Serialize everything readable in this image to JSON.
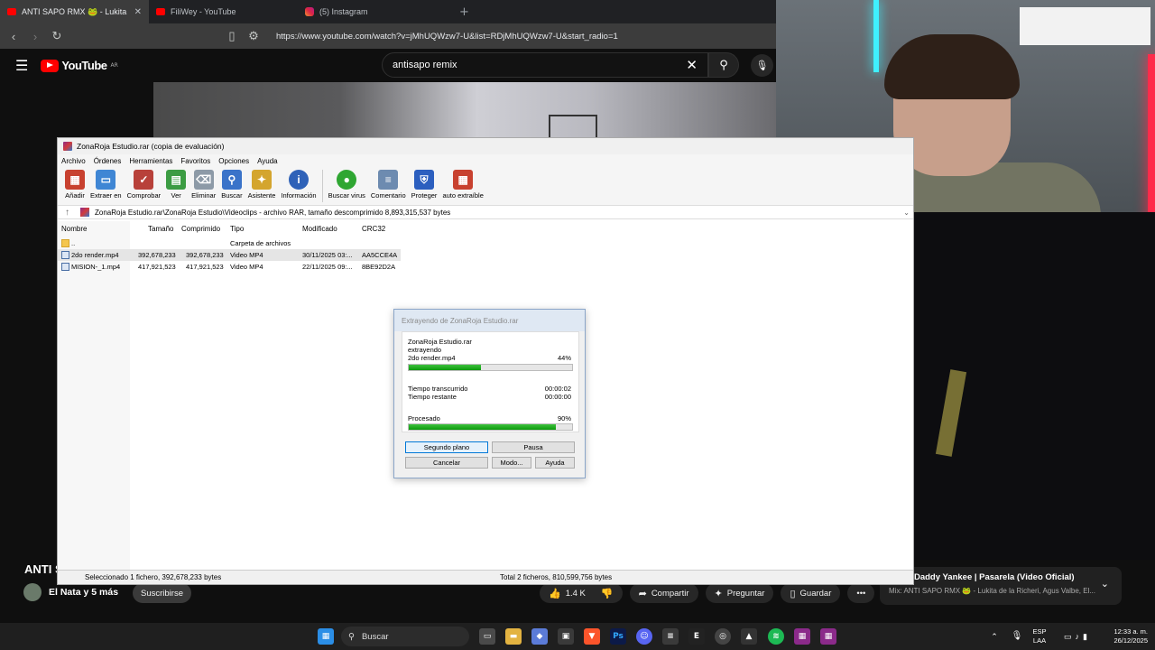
{
  "browser": {
    "tabs": [
      {
        "title": "ANTI SAPO RMX 🐸 - Lukita de",
        "close": "✕"
      },
      {
        "title": "FiliWey - YouTube"
      },
      {
        "title": "(5) Instagram"
      }
    ],
    "new_tab": "+",
    "url": "https://www.youtube.com/watch?v=jMhUQWzw7-U&list=RDjMhUQWzw7-U&start_radio=1"
  },
  "youtube": {
    "logo_text": "YouTube",
    "country": "AR",
    "search_value": "antisapo remix",
    "video_title": "ANTI S",
    "channel_name": "El Nata y 5 más",
    "subscribe_label": "Suscribirse",
    "likes": "1.4 K",
    "share_label": "Compartir",
    "ask_label": "Preguntar",
    "save_label": "Guardar",
    "more_label": "•••",
    "mix_now": "...nte: Daddy Yankee | Pasarela (Video Oficial)",
    "mix_sub": "Mix: ANTI SAPO RMX 🐸 - Lukita de la Richeri, Agus Valbe, El..."
  },
  "winrar": {
    "title": "ZonaRoja Estudio.rar (copia de evaluación)",
    "menu": [
      "Archivo",
      "Órdenes",
      "Herramientas",
      "Favoritos",
      "Opciones",
      "Ayuda"
    ],
    "toolbar": [
      {
        "label": "Añadir",
        "icon": "add-icon",
        "color": "#c8412f"
      },
      {
        "label": "Extraer en",
        "icon": "folder-extract-icon",
        "color": "#3f86d4"
      },
      {
        "label": "Comprobar",
        "icon": "test-icon",
        "color": "#b8413a"
      },
      {
        "label": "Ver",
        "icon": "view-icon",
        "color": "#3c9c43"
      },
      {
        "label": "Eliminar",
        "icon": "trash-icon",
        "color": "#8d9aa7"
      },
      {
        "label": "Buscar",
        "icon": "find-icon",
        "color": "#3a73c9"
      },
      {
        "label": "Asistente",
        "icon": "wizard-icon",
        "color": "#d4a52e"
      },
      {
        "label": "Información",
        "icon": "info-icon",
        "color": "#2f62b8"
      },
      {
        "label": "Buscar virus",
        "icon": "virus-scan-icon",
        "color": "#2fa632"
      },
      {
        "label": "Comentario",
        "icon": "comment-icon",
        "color": "#6d8bb0"
      },
      {
        "label": "Proteger",
        "icon": "shield-icon",
        "color": "#2c5fbf"
      },
      {
        "label": "auto extraíble",
        "icon": "sfx-icon",
        "color": "#c8412f"
      }
    ],
    "path": "ZonaRoja Estudio.rar\\ZonaRoja Estudio\\Videoclips - archivo RAR, tamaño descomprimido 8,893,315,537 bytes",
    "columns": [
      "Nombre",
      "Tamaño",
      "Comprimido",
      "Tipo",
      "Modificado",
      "CRC32"
    ],
    "files": [
      {
        "name": "..",
        "size": "",
        "packed": "",
        "type": "Carpeta de archivos",
        "modified": "",
        "crc": ""
      },
      {
        "name": "2do render.mp4",
        "size": "392,678,233",
        "packed": "392,678,233",
        "type": "Video MP4",
        "modified": "30/11/2025 03:...",
        "crc": "AA5CCE4A"
      },
      {
        "name": "MISION-_1.mp4",
        "size": "417,921,523",
        "packed": "417,921,523",
        "type": "Video MP4",
        "modified": "22/11/2025 09:...",
        "crc": "8BE92D2A"
      }
    ],
    "status_left": "Seleccionado 1 fichero, 392,678,233 bytes",
    "status_right": "Total 2 ficheros, 810,599,756 bytes"
  },
  "extract": {
    "title": "Extrayendo de ZonaRoja Estudio.rar",
    "archive": "ZonaRoja Estudio.rar",
    "action": "extrayendo",
    "file": "2do render.mp4",
    "file_percent": "44%",
    "file_progress": 0.44,
    "elapsed_label": "Tiempo transcurrido",
    "elapsed": "00:00:02",
    "remaining_label": "Tiempo restante",
    "remaining": "00:00:00",
    "processed_label": "Procesado",
    "processed_percent": "90%",
    "processed_progress": 0.9,
    "buttons": {
      "background": "Segundo plano",
      "pause": "Pausa",
      "cancel": "Cancelar",
      "mode": "Modo...",
      "help": "Ayuda"
    }
  },
  "taskbar": {
    "search_label": "Buscar",
    "lang": "ESP",
    "layout": "LAA",
    "time": "12:33 a. m.",
    "date": "26/12/2025"
  }
}
